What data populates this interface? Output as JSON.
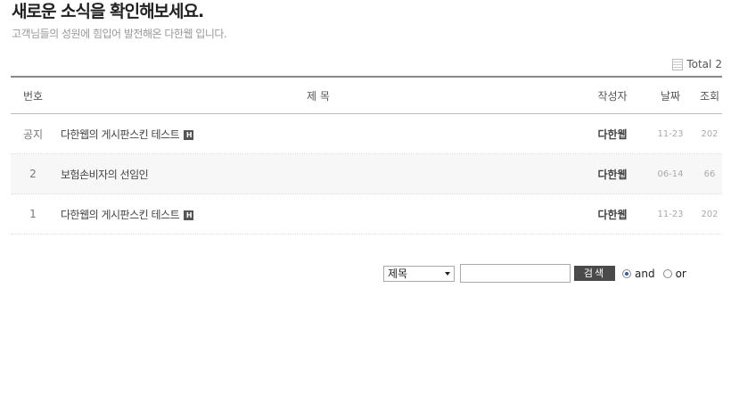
{
  "header": {
    "title": "새로운 소식을 확인해보세요.",
    "subtitle": "고객님들의 성원에 힘입어 발전해온 다한웹 입니다."
  },
  "total": {
    "label": "Total",
    "count": "2"
  },
  "table": {
    "columns": {
      "num": "번호",
      "title": "제 목",
      "writer": "작성자",
      "date": "날짜",
      "hits": "조회"
    },
    "rows": [
      {
        "num": "공지",
        "title": "다한웹의 게시판스킨 테스트",
        "badge": "H",
        "writer": "다한웹",
        "date": "11-23",
        "hits": "202"
      },
      {
        "num": "2",
        "title": "보험손비자의 선임인",
        "badge": "",
        "writer": "다한웹",
        "date": "06-14",
        "hits": "66"
      },
      {
        "num": "1",
        "title": "다한웹의 게시판스킨 테스트",
        "badge": "H",
        "writer": "다한웹",
        "date": "11-23",
        "hits": "202"
      }
    ]
  },
  "search": {
    "field_selected": "제목",
    "query": "",
    "button_label": "검색",
    "and_label": "and",
    "or_label": "or",
    "mode": "and"
  },
  "icons": {
    "total": "document-icon",
    "hot": "h-badge-icon",
    "dropdown": "chevron-down-icon"
  },
  "colors": {
    "header_border": "#888888",
    "button_bg": "#4a4a4a",
    "alt_row": "#f7f7f7"
  }
}
